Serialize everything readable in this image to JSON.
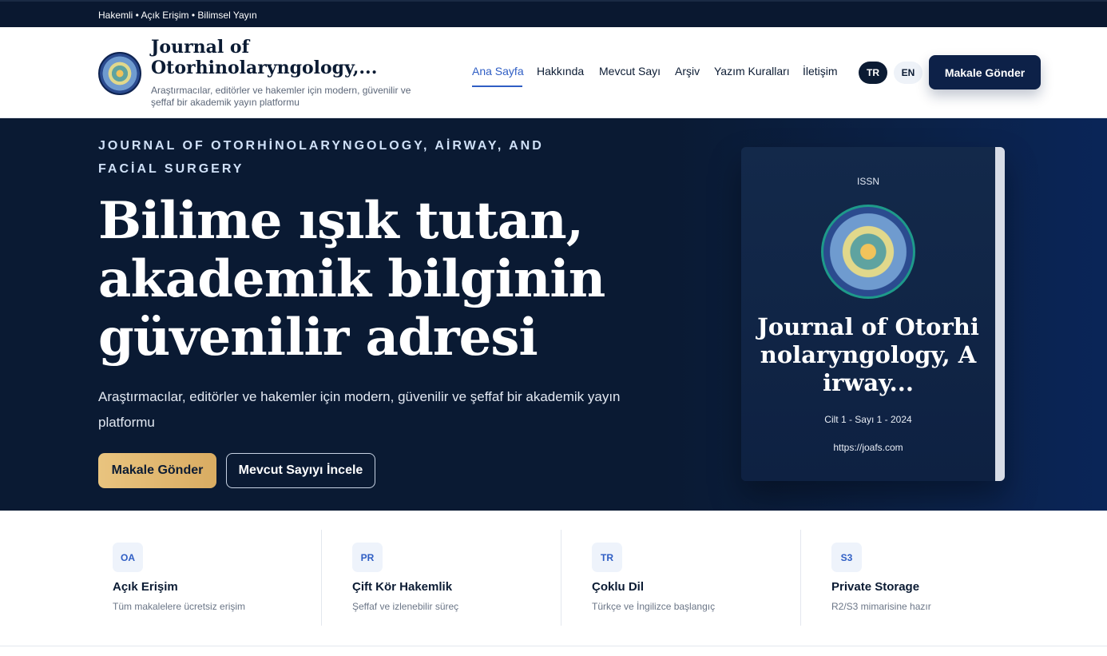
{
  "topbar": {
    "text": "Hakemli • Açık Erişim • Bilimsel Yayın"
  },
  "brand": {
    "title": "Journal of Otorhinolaryngology,...",
    "subtitle": "Araştırmacılar, editörler ve hakemler için modern, güvenilir ve şeffaf bir akademik yayın platformu",
    "logo_icon": "seahorse-logo-icon"
  },
  "nav": {
    "items": [
      {
        "label": "Ana Sayfa",
        "active": true
      },
      {
        "label": "Hakkında"
      },
      {
        "label": "Mevcut Sayı"
      },
      {
        "label": "Arşiv"
      },
      {
        "label": "Yazım Kuralları"
      },
      {
        "label": "İletişim"
      }
    ],
    "lang_tr": "TR",
    "lang_en": "EN",
    "submit": "Makale Gönder"
  },
  "hero": {
    "eyebrow": "JOURNAL OF OTORHİNOLARYNGOLOGY, AİRWAY, AND FACİAL SURGERY",
    "title": "Bilime ışık tutan, akademik bilginin güvenilir adresi",
    "description": "Araştırmacılar, editörler ve hakemler için modern, güvenilir ve şeffaf bir akademik yayın platformu",
    "primary_button": "Makale Gönder",
    "secondary_button": "Mevcut Sayıyı İncele"
  },
  "cover": {
    "issn": "ISSN",
    "title": "Journal of Otorhinolaryngology, Airway...",
    "volume": "Cilt 1 - Sayı 1 - 2024",
    "url": "https://joafs.com"
  },
  "features": [
    {
      "badge": "OA",
      "title": "Açık Erişim",
      "desc": "Tüm makalelere ücretsiz erişim"
    },
    {
      "badge": "PR",
      "title": "Çift Kör Hakemlik",
      "desc": "Şeffaf ve izlenebilir süreç"
    },
    {
      "badge": "TR",
      "title": "Çoklu Dil",
      "desc": "Türkçe ve İngilizce başlangıç"
    },
    {
      "badge": "S3",
      "title": "Private Storage",
      "desc": "R2/S3 mimarisine hazır"
    }
  ],
  "colors": {
    "navy": "#0a1830",
    "accent_blue": "#2f5ec4",
    "gold": "#e9c47f"
  }
}
